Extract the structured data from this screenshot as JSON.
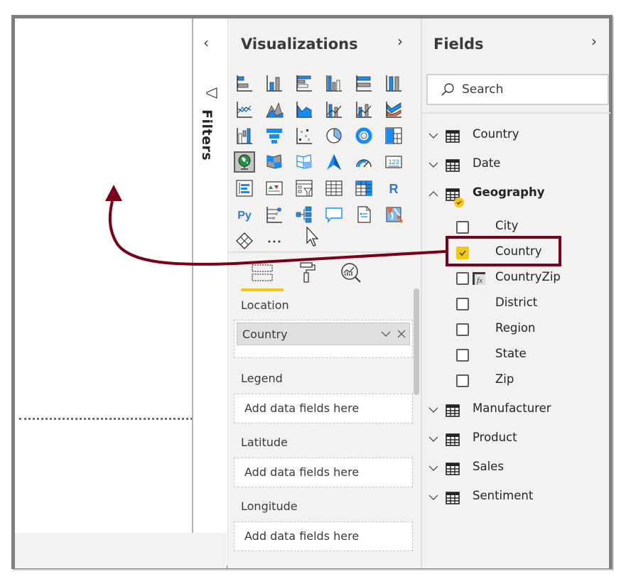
{
  "filters_pane": {
    "label": "Filters",
    "expand_icon": "chevron-left-icon",
    "filter_icon": "funnel-icon"
  },
  "visualizations": {
    "title": "Visualizations",
    "collapse_icon": "chevron-right-icon",
    "icons": [
      "stacked-bar-chart",
      "stacked-column-chart",
      "clustered-bar-chart",
      "clustered-column-chart",
      "100-stacked-bar-chart",
      "100-stacked-column-chart",
      "line-chart",
      "area-chart",
      "stacked-area-chart",
      "line-and-stacked-column-chart",
      "line-and-clustered-column-chart",
      "ribbon-chart",
      "waterfall-chart",
      "funnel",
      "scatter-chart",
      "pie-chart",
      "donut-chart",
      "treemap",
      "map",
      "filled-map",
      "shape-map",
      "azure-map",
      "gauge",
      "card",
      "multi-row-card",
      "kpi",
      "slicer",
      "table",
      "matrix",
      "r-script-visual",
      "python-visual",
      "key-influencers",
      "decomposition-tree",
      "qa",
      "paginated-report",
      "arcgis-maps",
      "power-apps",
      "more-visuals"
    ],
    "selected_icon": "map",
    "more_label": "...",
    "r_label": "R",
    "py_label": "Py",
    "card_label": "123",
    "tabs": [
      {
        "name": "fields-tab",
        "icon": "fields-icon",
        "active": true
      },
      {
        "name": "format-tab",
        "icon": "paint-roller-icon",
        "active": false
      },
      {
        "name": "analytics-tab",
        "icon": "analytics-icon",
        "active": false
      }
    ],
    "wells": [
      {
        "label": "Location",
        "value": "Country",
        "placeholder": null
      },
      {
        "label": "Legend",
        "value": null,
        "placeholder": "Add data fields here"
      },
      {
        "label": "Latitude",
        "value": null,
        "placeholder": "Add data fields here"
      },
      {
        "label": "Longitude",
        "value": null,
        "placeholder": "Add data fields here"
      }
    ]
  },
  "fields": {
    "title": "Fields",
    "collapse_icon": "chevron-right-icon",
    "search_placeholder": "Search",
    "tables": [
      {
        "name": "Country",
        "expanded": false,
        "has_selection": false
      },
      {
        "name": "Date",
        "expanded": false,
        "has_selection": false
      },
      {
        "name": "Geography",
        "expanded": true,
        "has_selection": true,
        "fields": [
          {
            "name": "City",
            "checked": false,
            "calculated": false
          },
          {
            "name": "Country",
            "checked": true,
            "calculated": false
          },
          {
            "name": "CountryZip",
            "checked": false,
            "calculated": true
          },
          {
            "name": "District",
            "checked": false,
            "calculated": false
          },
          {
            "name": "Region",
            "checked": false,
            "calculated": false
          },
          {
            "name": "State",
            "checked": false,
            "calculated": false
          },
          {
            "name": "Zip",
            "checked": false,
            "calculated": false
          }
        ]
      },
      {
        "name": "Manufacturer",
        "expanded": false,
        "has_selection": false
      },
      {
        "name": "Product",
        "expanded": false,
        "has_selection": false
      },
      {
        "name": "Sales",
        "expanded": false,
        "has_selection": false
      },
      {
        "name": "Sentiment",
        "expanded": false,
        "has_selection": false
      }
    ]
  },
  "annotation": {
    "color": "#7a0019",
    "highlight_target": "Geography.Country",
    "arrow_description": "Arrow from checked Country field to report canvas"
  },
  "colors": {
    "accent_yellow": "#f2c811",
    "pane_bg": "#f3f2f1",
    "icon_blue": "#118dff",
    "annotation_red": "#7a0019"
  }
}
